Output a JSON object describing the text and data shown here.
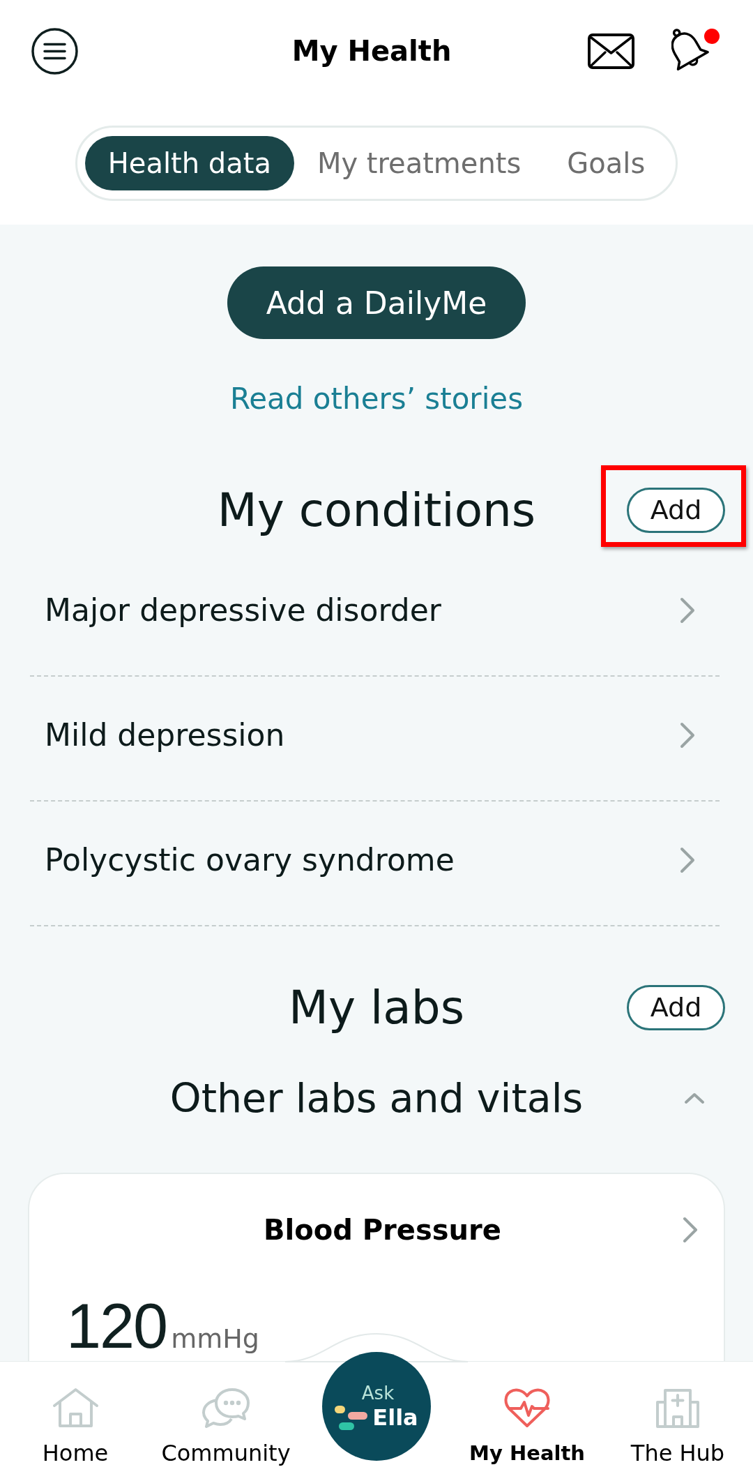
{
  "header": {
    "title": "My Health",
    "notification_dot": true
  },
  "tabs": [
    {
      "label": "Health data",
      "selected": true
    },
    {
      "label": "My treatments",
      "selected": false
    },
    {
      "label": "Goals",
      "selected": false
    }
  ],
  "daily_me_button": "Add a DailyMe",
  "stories_link": "Read others’ stories",
  "conditions": {
    "title": "My conditions",
    "add_button": {
      "label": "Add",
      "highlighted": true
    },
    "items": [
      "Major depressive disorder",
      "Mild depression",
      "Polycystic ovary syndrome"
    ]
  },
  "labs": {
    "title": "My labs",
    "add_button": {
      "label": "Add"
    },
    "group": {
      "title": "Other labs and vitals",
      "expanded": true,
      "cards": [
        {
          "title": "Blood Pressure",
          "value": "120",
          "unit": "mmHg"
        }
      ]
    }
  },
  "bottom_nav": {
    "items": [
      {
        "label": "Home",
        "selected": false
      },
      {
        "label": "Community",
        "selected": false
      },
      {
        "label": "My Health",
        "selected": true
      },
      {
        "label": "The Hub",
        "selected": false
      }
    ],
    "center_button": {
      "top_text": "Ask",
      "main_text": "Ella"
    }
  }
}
